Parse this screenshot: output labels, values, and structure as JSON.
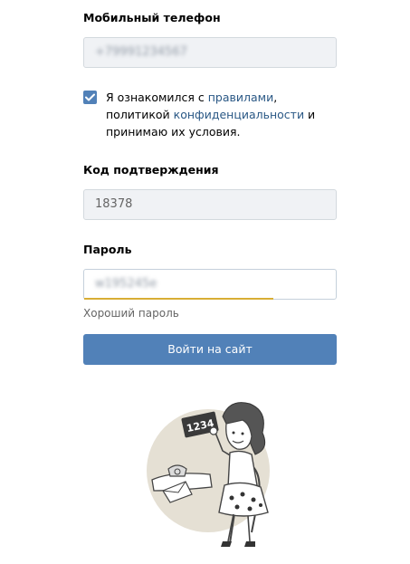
{
  "phone": {
    "label": "Мобильный телефон",
    "value": "+79991234567"
  },
  "agreement": {
    "checked": true,
    "text_before": "Я ознакомился с ",
    "link_rules": "правилами",
    "text_middle": ", политикой ",
    "link_privacy": "конфиденциальности",
    "text_after": " и принимаю их условия."
  },
  "code": {
    "label": "Код подтверждения",
    "value": "18378"
  },
  "password": {
    "label": "Пароль",
    "value": "w195245e",
    "strength_text": "Хороший пароль",
    "strength_fraction": 0.75
  },
  "submit": {
    "label": "Войти на сайт"
  },
  "illustration": {
    "sign_text": "1234"
  },
  "colors": {
    "accent": "#5181b8",
    "link": "#2a5885",
    "strength": "#d8ae35"
  }
}
